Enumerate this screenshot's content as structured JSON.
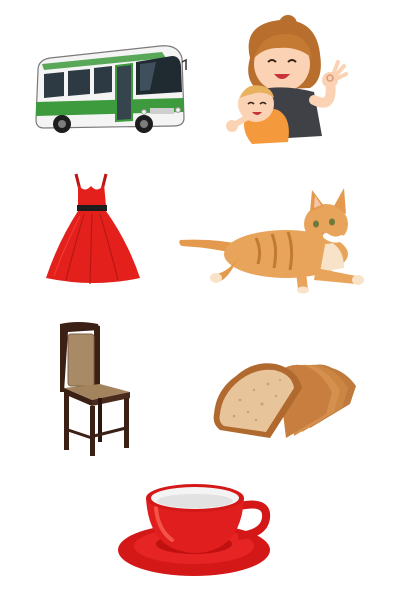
{
  "page": {
    "background_color": "#ffffff"
  },
  "pictures": [
    {
      "id": "bus",
      "icon": "bus-icon",
      "accent_color": "#3d9a3d"
    },
    {
      "id": "mother-with-baby",
      "icon": "mother-baby-icon",
      "accent_color": "#f59a3c"
    },
    {
      "id": "dress",
      "icon": "dress-icon",
      "accent_color": "#e3201c"
    },
    {
      "id": "cat",
      "icon": "cat-icon",
      "accent_color": "#e39a4e"
    },
    {
      "id": "chair",
      "icon": "chair-icon",
      "accent_color": "#4a2a1c"
    },
    {
      "id": "bread",
      "icon": "bread-icon",
      "accent_color": "#d9a06a"
    },
    {
      "id": "cup",
      "icon": "cup-icon",
      "accent_color": "#e01e1e"
    }
  ]
}
